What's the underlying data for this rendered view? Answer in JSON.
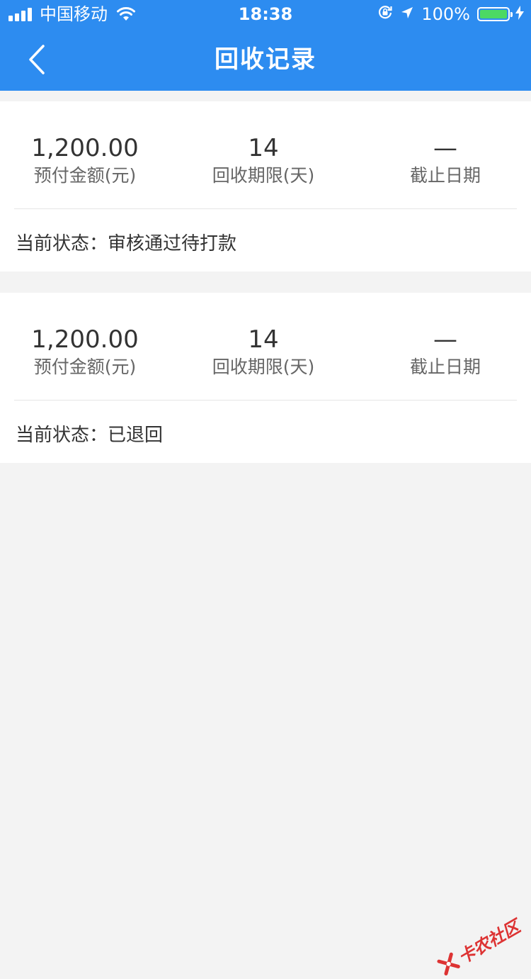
{
  "status_bar": {
    "carrier": "中国移动",
    "time": "18:38",
    "battery": "100%"
  },
  "nav": {
    "title": "回收记录",
    "back_icon": "chevron-left-icon"
  },
  "records": [
    {
      "amount": "1,200.00",
      "amount_label": "预付金额(元)",
      "term": "14",
      "term_label": "回收期限(天)",
      "deadline": "—",
      "deadline_label": "截止日期",
      "status_label": "当前状态：",
      "status": "审核通过待打款"
    },
    {
      "amount": "1,200.00",
      "amount_label": "预付金额(元)",
      "term": "14",
      "term_label": "回收期限(天)",
      "deadline": "—",
      "deadline_label": "截止日期",
      "status_label": "当前状态：",
      "status": "已退回"
    }
  ],
  "watermark": {
    "text": "卡农社区"
  },
  "colors": {
    "accent": "#2d8cf0",
    "background": "#f3f3f3",
    "battery_fill": "#4cd964"
  }
}
